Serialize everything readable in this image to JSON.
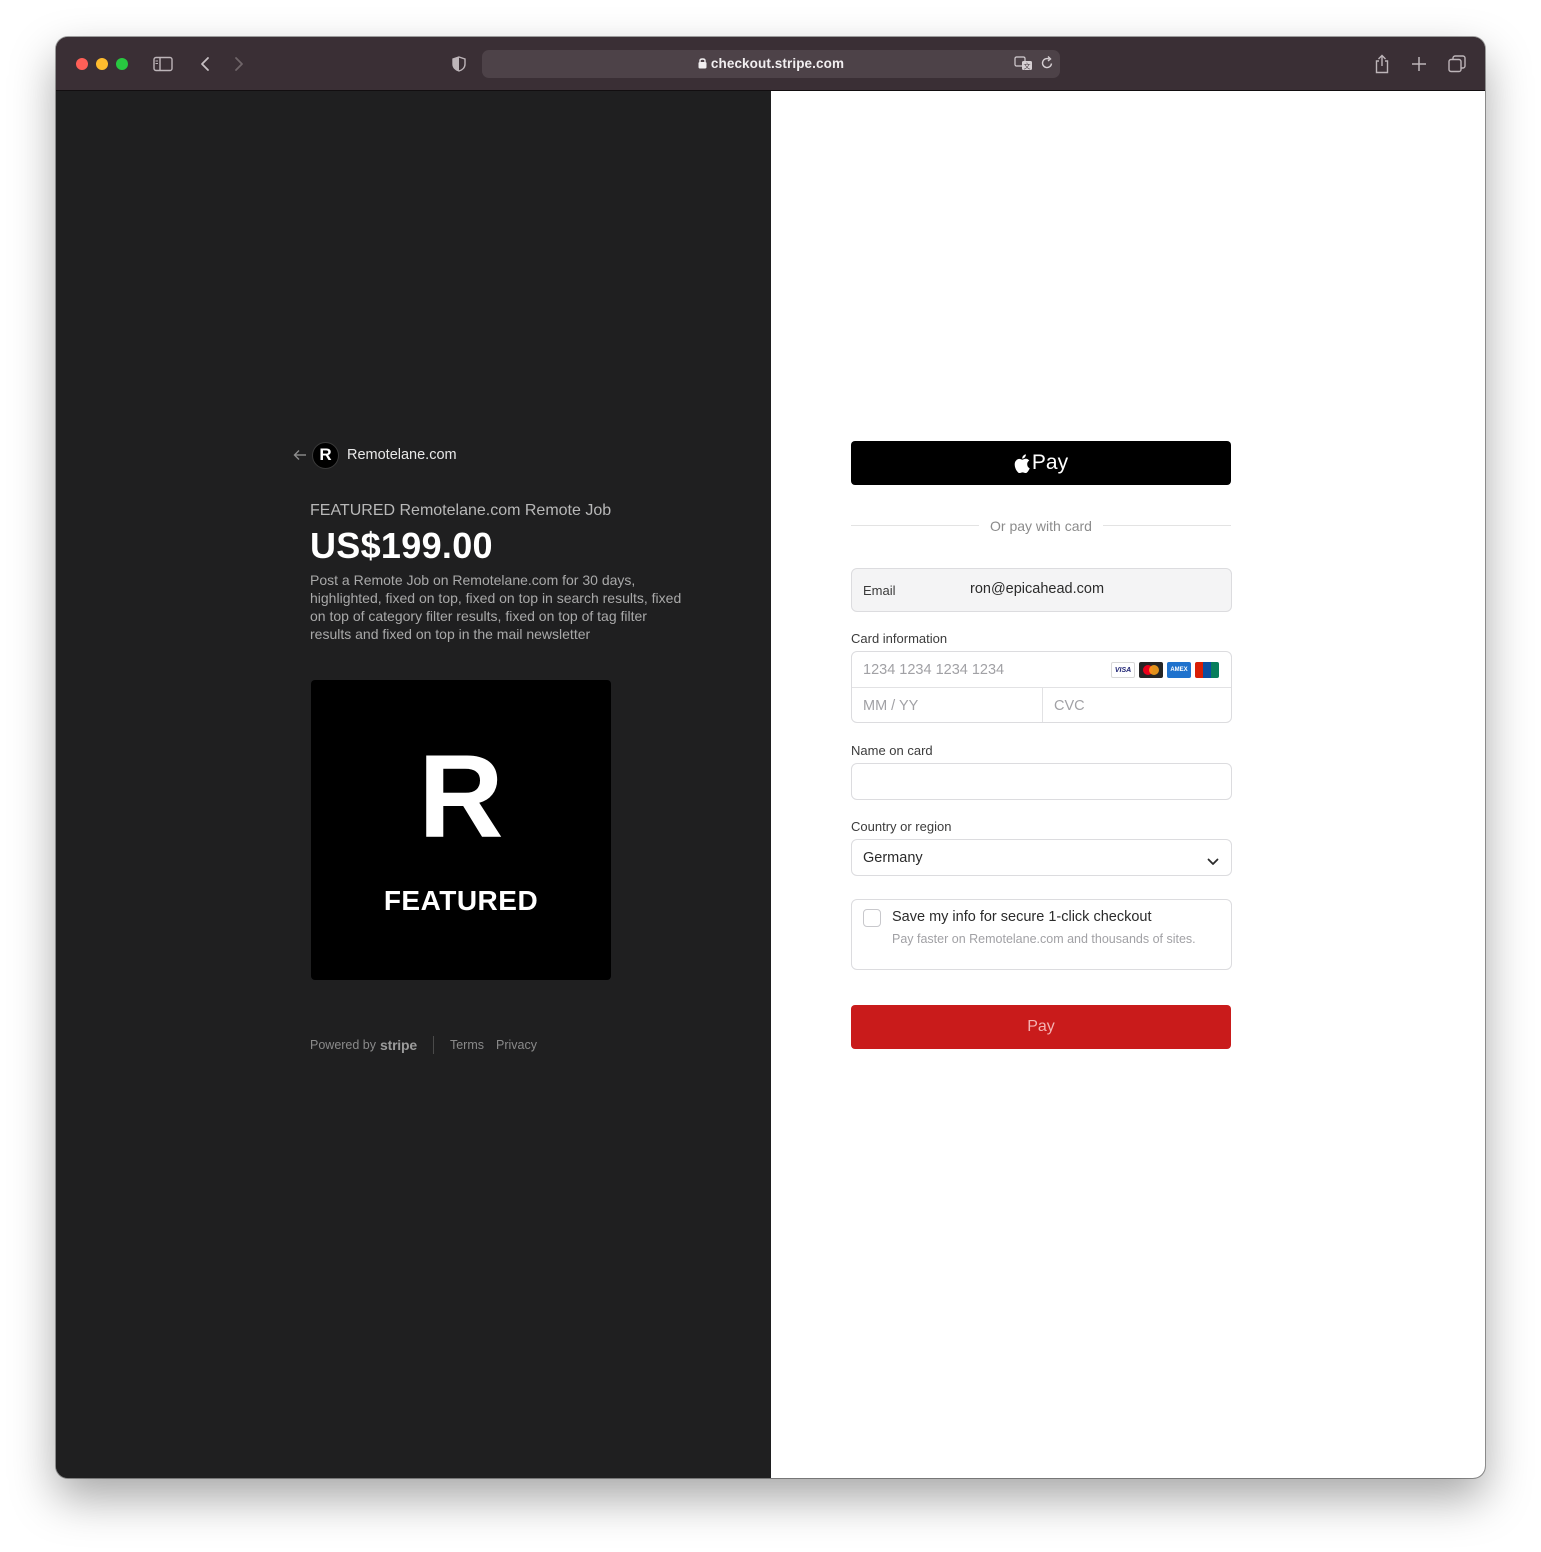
{
  "browser": {
    "url": "checkout.stripe.com"
  },
  "merchant": {
    "logo_letter": "R",
    "name": "Remotelane.com"
  },
  "product": {
    "name": "FEATURED Remotelane.com Remote Job",
    "price": "US$199.00",
    "description": "Post a Remote Job on Remotelane.com for 30 days, highlighted, fixed on top, fixed on top in search results, fixed on top of category filter results, fixed on top of tag filter results and fixed on top in the mail newsletter",
    "image_letter": "R",
    "image_caption": "FEATURED"
  },
  "footer": {
    "powered_by": "Powered by",
    "stripe": "stripe",
    "terms": "Terms",
    "privacy": "Privacy"
  },
  "payment": {
    "apple_pay_label": "Pay",
    "divider_text": "Or pay with card",
    "email_label": "Email",
    "email_value": "ron@epicahead.com",
    "card_label": "Card information",
    "card_number_placeholder": "1234 1234 1234 1234",
    "expiry_placeholder": "MM / YY",
    "cvc_placeholder": "CVC",
    "card_brands": [
      "VISA",
      "mastercard",
      "AMEX",
      "UnionPay"
    ],
    "name_label": "Name on card",
    "country_label": "Country or region",
    "country_value": "Germany",
    "save_title": "Save my info for secure 1-click checkout",
    "save_subtitle": "Pay faster on Remotelane.com and thousands of sites.",
    "pay_button": "Pay"
  },
  "colors": {
    "pay_button": "#c91b1b",
    "left_panel": "#1f1f20",
    "titlebar": "#3a2f35"
  }
}
